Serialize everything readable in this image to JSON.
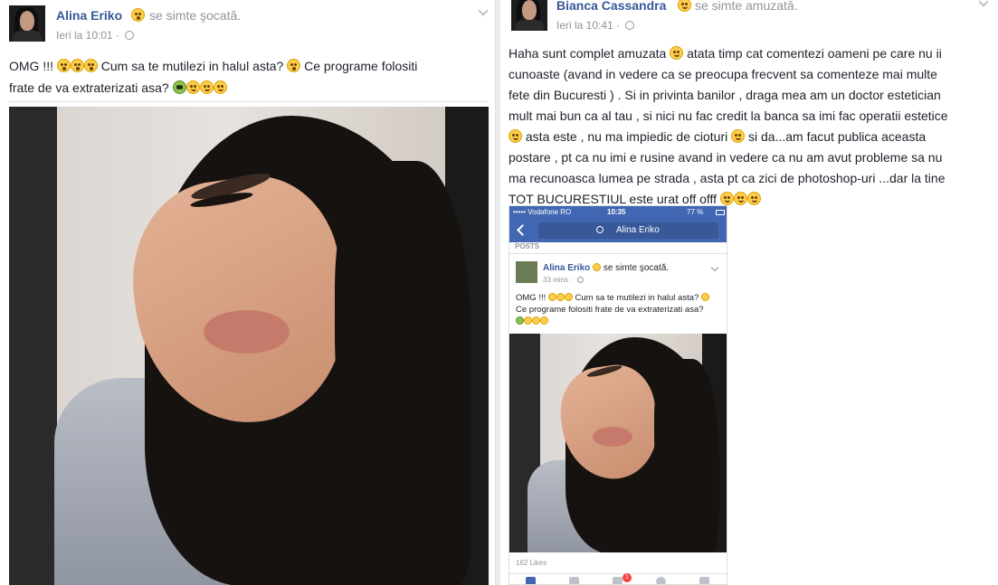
{
  "left_post": {
    "author": "Alina Eriko",
    "feeling_emoji": "shocked-emoji-icon",
    "feeling": "se simte şocată.",
    "timestamp": "Ieri la 10:01",
    "audience_icon": "globe-icon",
    "text_line1_a": "OMG !!!",
    "text_line1_b": "Cum sa te mutilezi in halul asta?",
    "text_line1_c": "Ce programe folositi",
    "text_line2": "frate de va extraterizati asa?",
    "photo_alt": "selfie-photo"
  },
  "right_post": {
    "author": "Bianca Cassandra",
    "feeling_emoji": "laughing-emoji-icon",
    "feeling": "se simte amuzată.",
    "timestamp": "Ieri la 10:41",
    "audience_icon": "globe-icon",
    "lines": [
      "Haha sunt complet amuzata",
      "atata timp cat comentezi oameni pe care nu ii",
      "cunoaste (avand in vedere ca se preocupa frecvent sa comenteze mai multe",
      "fete din Bucuresti ) . Si in privinta banilor , draga mea am un doctor estetician",
      "mult mai bun ca al tau , si nici nu fac credit la banca sa imi fac operatii estetice",
      "asta este , nu ma impiedic de cioturi",
      "si da...am facut publica aceasta",
      "postare , pt ca nu imi e rusine avand in vedere ca nu am avut probleme sa nu",
      "ma recunoasca lumea pe strada , asta pt ca zici de photoshop-uri ...dar la tine",
      "TOT BUCURESTIUL este urat off offf"
    ]
  },
  "phone": {
    "carrier": "••••• Vodafone RO",
    "time": "10:35",
    "battery": "77 %",
    "search_text": "Alina Eriko",
    "section_label": "POSTS",
    "post_author": "Alina Eriko",
    "post_feeling": "se simte şocată.",
    "post_time": "33 mins",
    "post_text_1": "OMG !!!",
    "post_text_2": "Cum sa te mutilezi in halul asta?",
    "post_text_3": "Ce programe folositi frate de va extraterizati asa?",
    "likes": "162 Likes",
    "notification_count": "1"
  },
  "colors": {
    "brand_blue": "#4267b2",
    "link_blue": "#365899",
    "meta_gray": "#90949c"
  }
}
